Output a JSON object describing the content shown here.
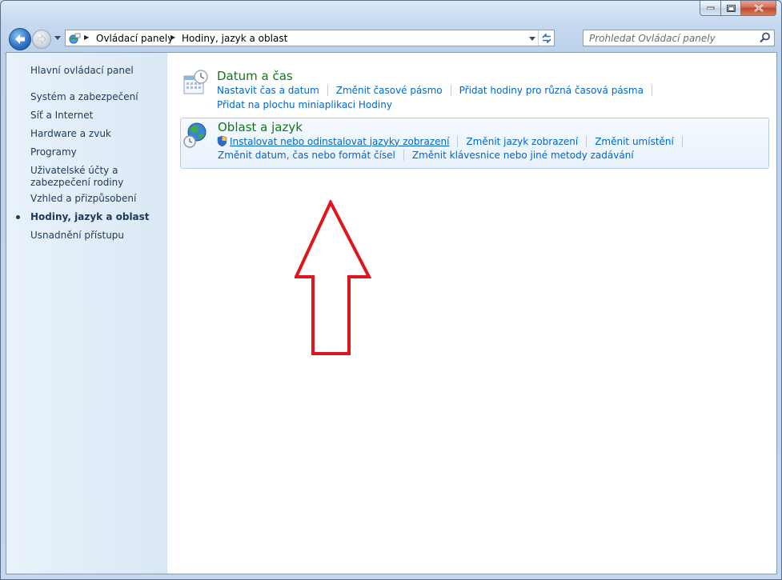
{
  "address": {
    "crumbs": [
      "Ovládací panely",
      "Hodiny, jazyk a oblast"
    ]
  },
  "search": {
    "placeholder": "Prohledat Ovládací panely"
  },
  "sidebar": {
    "home": "Hlavní ovládací panel",
    "items": [
      {
        "label": "Systém a zabezpečení"
      },
      {
        "label": "Síť a Internet"
      },
      {
        "label": "Hardware a zvuk"
      },
      {
        "label": "Programy"
      },
      {
        "label": "Uživatelské účty a zabezpečení rodiny"
      },
      {
        "label": "Vzhled a přizpůsobení"
      },
      {
        "label": "Hodiny, jazyk a oblast",
        "active": true
      },
      {
        "label": "Usnadnění přístupu"
      }
    ]
  },
  "categories": [
    {
      "title": "Datum a čas",
      "links": [
        "Nastavit čas a datum",
        "Změnit časové pásmo",
        "Přidat hodiny pro různá časová pásma",
        "Přidat na plochu miniaplikaci Hodiny"
      ]
    },
    {
      "title": "Oblast a jazyk",
      "links": [
        "Instalovat nebo odinstalovat jazyky zobrazení",
        "Změnit jazyk zobrazení",
        "Změnit umístění",
        "Změnit datum, čas nebo formát čísel",
        "Změnit klávesnice nebo jiné metody zadávání"
      ]
    }
  ],
  "colors": {
    "category_title": "#10771a",
    "link": "#0066cc",
    "annotation_arrow": "#e0161d"
  },
  "icons": [
    "back-arrow-icon",
    "forward-arrow-icon",
    "control-panel-icon",
    "refresh-icon",
    "search-icon",
    "calendar-clock-icon",
    "globe-clock-icon",
    "uac-shield-icon"
  ]
}
